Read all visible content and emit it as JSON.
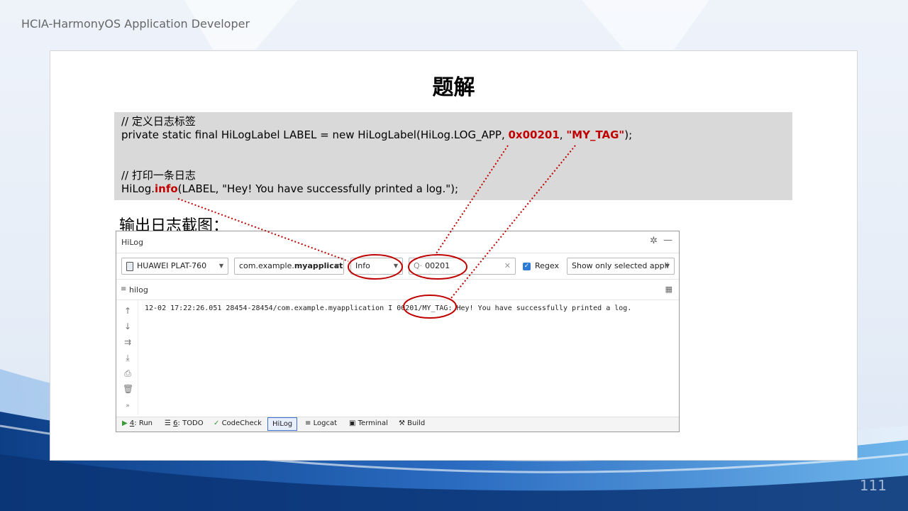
{
  "slide": {
    "header": "HCIA-HarmonyOS Application Developer",
    "title": "题解",
    "page_number": "111",
    "subheading": "输出日志截图："
  },
  "code": {
    "comment1": "// 定义日志标签",
    "line2_pre": "private static final HiLogLabel LABEL = new HiLogLabel(HiLog.LOG_APP, ",
    "domain": "0x00201",
    "sep": ", ",
    "tag": "\"MY_TAG\"",
    "line2_post": ");",
    "comment2": "// 打印一条日志",
    "line4_pre": "HiLog.",
    "method": "info",
    "line4_post": "(LABEL, \"Hey! You have successfully printed a log.\");"
  },
  "hilog": {
    "window_title": "HiLog",
    "device": "HUAWEI PLAT-760",
    "package_prefix": "com.example.",
    "package_bold": "myapplicat",
    "level": "Info",
    "search_value": "00201",
    "regex_label": "Regex",
    "regex_checked": true,
    "filter": "Show only selected appli",
    "tab_label": "hilog",
    "log_line": "12-02 17:22:26.051 28454-28454/com.example.myapplication I 00201/MY_TAG: Hey! You have successfully printed a log.",
    "bottom_tabs": {
      "run_num": "4",
      "run_label": ": Run",
      "todo_num": "6",
      "todo_label": ": TODO",
      "codecheck": "CodeCheck",
      "hilog": "HiLog",
      "logcat": "Logcat",
      "terminal": "Terminal",
      "build": "Build"
    }
  },
  "colors": {
    "highlight_red": "#c00000",
    "annotation_red": "#c00000",
    "code_bg": "#d9d9d9",
    "checkbox_blue": "#2e7bd6"
  }
}
